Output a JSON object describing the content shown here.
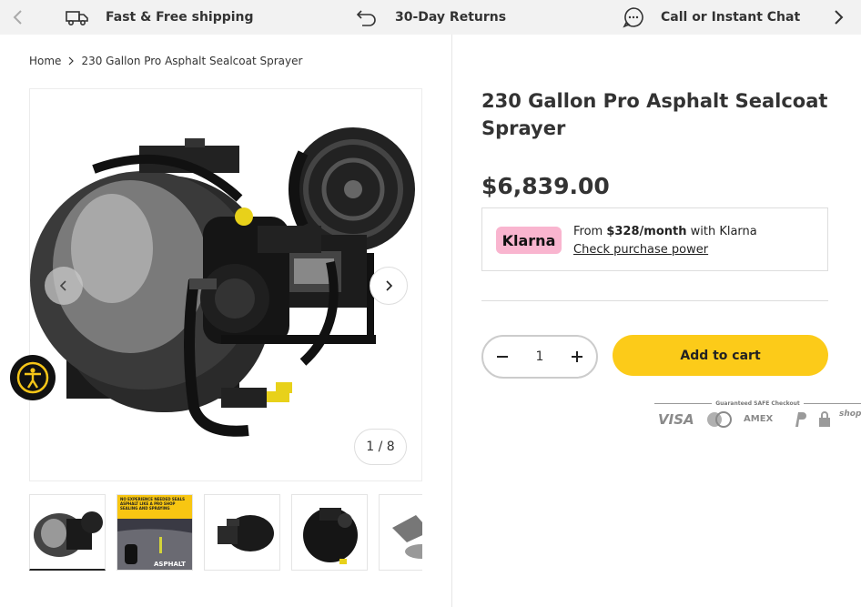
{
  "announcements": [
    {
      "icon": "truck-icon",
      "text": "Fast & Free shipping"
    },
    {
      "icon": "return-arrow-icon",
      "text": "30-Day Returns"
    },
    {
      "icon": "chat-icon",
      "text": "Call or Instant Chat"
    }
  ],
  "breadcrumb": {
    "home": "Home",
    "current": "230 Gallon Pro Asphalt Sealcoat Sprayer"
  },
  "gallery": {
    "counter": "1 / 8"
  },
  "thumbnails": {
    "thumb2_headline": "NO EXPERIENCE NEEDED SEALS ASPHALT LIKE A PRO SHOP SEALING AND SPRAYING",
    "thumb2_brand": "ASPHALT"
  },
  "product": {
    "title": "230 Gallon Pro Asphalt Sealcoat Sprayer",
    "price": "$6,839.00"
  },
  "klarna": {
    "badge": "Klarna",
    "from": "From ",
    "amount": "$328/month",
    "suffix": " with Klarna",
    "link": "Check purchase power"
  },
  "quantity": {
    "value": "1"
  },
  "cart": {
    "label": "Add to cart"
  },
  "checkout": {
    "label": "Guaranteed SAFE Checkout",
    "methods": [
      "VISA",
      "AMEX",
      "shop"
    ]
  },
  "colors": {
    "accent": "#fccb19",
    "klarna_pink": "#f9b5cf",
    "topbar": "#f2f2f2"
  }
}
